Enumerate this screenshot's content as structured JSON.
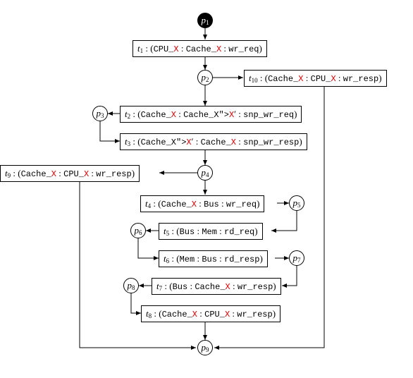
{
  "places": {
    "p1": "p1",
    "p2": "p2",
    "p3": "p3",
    "p4": "p4",
    "p5": "p5",
    "p6": "p6",
    "p7": "p7",
    "p8": "p8",
    "p9": "p9"
  },
  "transitions": {
    "t1": {
      "id": "t1",
      "src": "CPU_X",
      "dst": "Cache_X",
      "msg": "wr_req"
    },
    "t2": {
      "id": "t2",
      "src": "Cache_X",
      "dst": "Cache_X'",
      "msg": "snp_wr_req"
    },
    "t3": {
      "id": "t3",
      "src": "Cache_X'",
      "dst": "Cache_X",
      "msg": "snp_wr_resp"
    },
    "t4": {
      "id": "t4",
      "src": "Cache_X",
      "dst": "Bus",
      "msg": "wr_req"
    },
    "t5": {
      "id": "t5",
      "src": "Bus",
      "dst": "Mem",
      "msg": "rd_req"
    },
    "t6": {
      "id": "t6",
      "src": "Mem",
      "dst": "Bus",
      "msg": "rd_resp"
    },
    "t7": {
      "id": "t7",
      "src": "Bus",
      "dst": "Cache_X",
      "msg": "wr_resp"
    },
    "t8": {
      "id": "t8",
      "src": "Cache_X",
      "dst": "CPU_X",
      "msg": "wr_resp"
    },
    "t9": {
      "id": "t9",
      "src": "Cache_X",
      "dst": "CPU_X",
      "msg": "wr_resp"
    },
    "t10": {
      "id": "t10",
      "src": "Cache_X",
      "dst": "CPU_X",
      "msg": "wr_resp"
    }
  },
  "edges": [
    [
      "p1",
      "t1"
    ],
    [
      "t1",
      "p2"
    ],
    [
      "p2",
      "t2"
    ],
    [
      "p2",
      "t10"
    ],
    [
      "t2",
      "p3"
    ],
    [
      "p3",
      "t3"
    ],
    [
      "t3",
      "p4"
    ],
    [
      "p4",
      "t9"
    ],
    [
      "p4",
      "t4"
    ],
    [
      "t4",
      "p5"
    ],
    [
      "p5",
      "t5"
    ],
    [
      "t5",
      "p6"
    ],
    [
      "p6",
      "t6"
    ],
    [
      "t6",
      "p7"
    ],
    [
      "p7",
      "t7"
    ],
    [
      "t7",
      "p8"
    ],
    [
      "p8",
      "t8"
    ],
    [
      "t8",
      "p9"
    ],
    [
      "t9",
      "p9"
    ],
    [
      "t10",
      "p9"
    ]
  ],
  "initial_marking": [
    "p1"
  ]
}
